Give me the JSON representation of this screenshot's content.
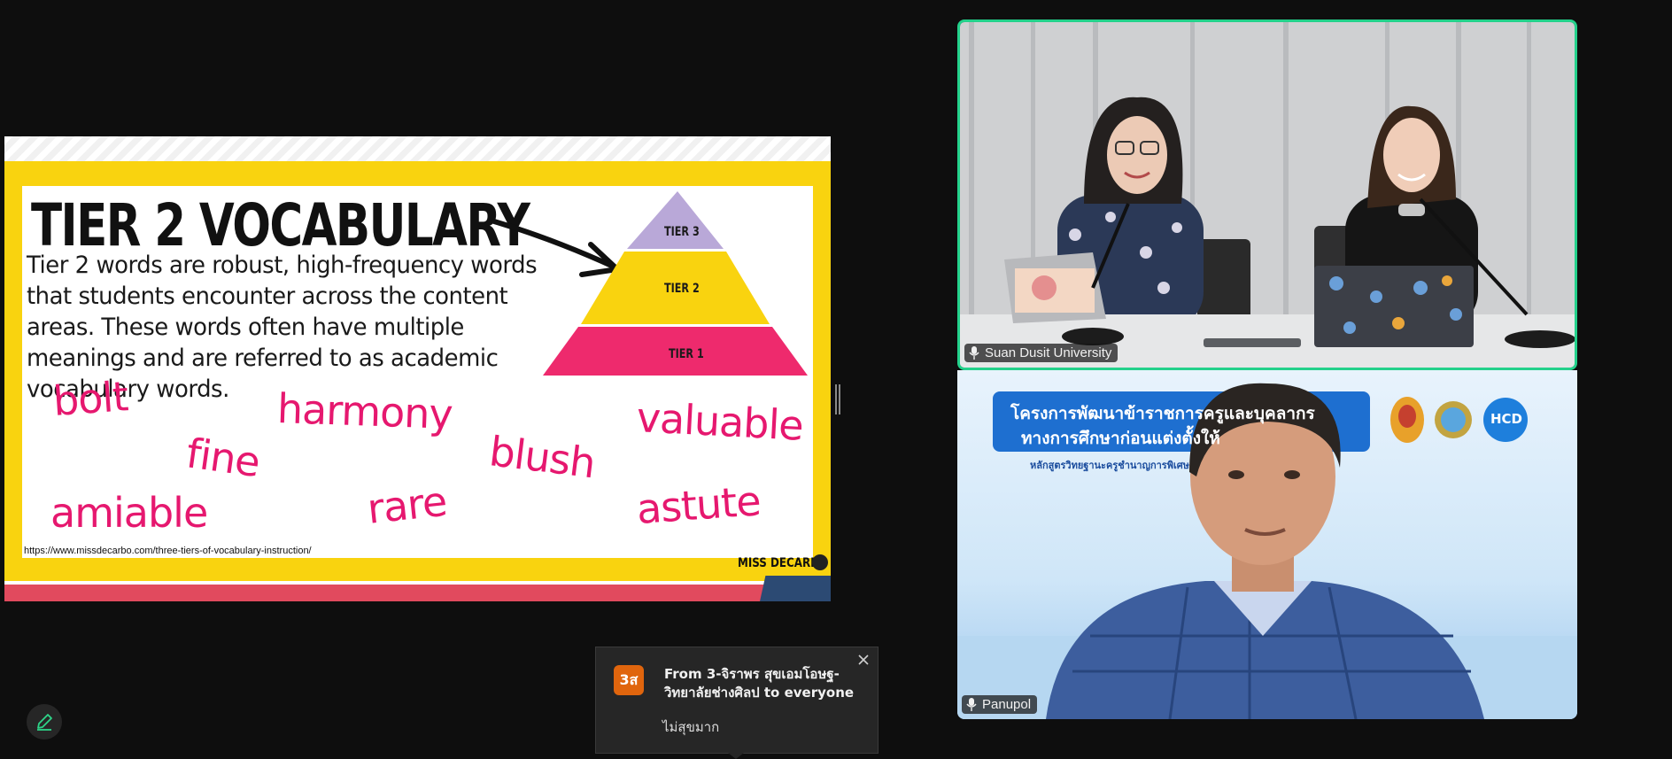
{
  "slide": {
    "title": "TIER 2 VOCABULARY",
    "body": "Tier 2 words are robust, high-frequency words that students encounter across the content areas. These words often have multiple meanings and are referred to as academic vocabulary words.",
    "pyramid": {
      "tier3": "TIER 3",
      "tier2": "TIER 2",
      "tier1": "TIER 1",
      "colors": {
        "tier3": "#b9a8d8",
        "tier2": "#f9d30f",
        "tier1": "#ee2a6d"
      }
    },
    "words": {
      "bolt": "bolt",
      "harmony": "harmony",
      "valuable": "valuable",
      "fine": "fine",
      "blush": "blush",
      "amiable": "amiable",
      "rare": "rare",
      "astute": "astute"
    },
    "source_url": "https://www.missdecarbo.com/three-tiers-of-vocabulary-instruction/",
    "brand": "MISS DECARBO",
    "colors": {
      "frame": "#f9d30f",
      "word": "#e6186f",
      "stripe_bottom": "#e14a5e"
    }
  },
  "participants": [
    {
      "name": "Suan Dusit University",
      "active_speaker": true
    },
    {
      "name": "Panupol",
      "active_speaker": false
    }
  ],
  "backdrop": {
    "banner_line1": "โครงการพัฒนาข้าราชการครูและบุคลากร",
    "banner_line2": "ทางการศึกษาก่อนแต่งตั้งให้",
    "subtitle": "หลักสูตรวิทยฐานะครูชำนาญการพิเศษ",
    "hcd_logo": "HCD"
  },
  "chat_toast": {
    "avatar_initials": "3ส",
    "sender_line": "From 3-จิราพร สุขเอมโอษฐ-วิทยาลัยช่างศิลป to everyone",
    "message": "ไม่สุขมาก"
  },
  "icons": {
    "close": "close-icon",
    "edit": "pencil-icon",
    "mic": "microphone-muted-icon"
  },
  "accent_color": "#23d18b"
}
